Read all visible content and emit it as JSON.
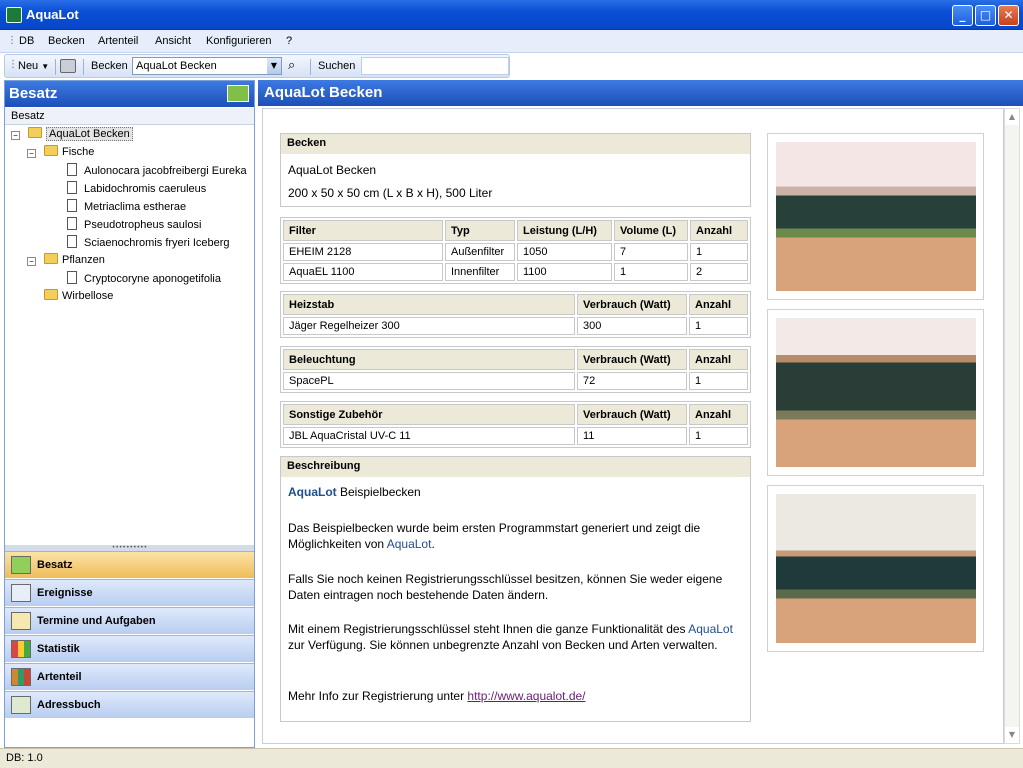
{
  "window": {
    "title": "AquaLot"
  },
  "menu": {
    "items": [
      "DB",
      "Becken",
      "Artenteil",
      "Ansicht",
      "Konfigurieren",
      "?"
    ]
  },
  "toolbar": {
    "new_label": "Neu",
    "becken_label": "Becken",
    "becken_value": "AquaLot Becken",
    "search_label": "Suchen",
    "search_value": ""
  },
  "left": {
    "header": "Besatz",
    "subheader": "Besatz",
    "tree": {
      "root": "AquaLot Becken",
      "fische_label": "Fische",
      "fische": [
        "Aulonocara jacobfreibergi Eureka",
        "Labidochromis caeruleus",
        "Metriaclima estherae",
        "Pseudotropheus saulosi",
        "Sciaenochromis fryeri Iceberg"
      ],
      "pflanzen_label": "Pflanzen",
      "pflanzen": [
        "Cryptocoryne aponogetifolia"
      ],
      "wirbellose_label": "Wirbellose"
    },
    "nav": [
      "Besatz",
      "Ereignisse",
      "Termine und Aufgaben",
      "Statistik",
      "Artenteil",
      "Adressbuch"
    ]
  },
  "main": {
    "header": "AquaLot Becken",
    "becken": {
      "title": "Becken",
      "name": "AquaLot Becken",
      "dimensions": "200 x 50 x 50 cm (L x B x H), 500 Liter"
    },
    "filter": {
      "headers": [
        "Filter",
        "Typ",
        "Leistung (L/H)",
        "Volume (L)",
        "Anzahl"
      ],
      "rows": [
        [
          "EHEIM 2128",
          "Außenfilter",
          "1050",
          "7",
          "1"
        ],
        [
          "AquaEL 1100",
          "Innenfilter",
          "1100",
          "1",
          "2"
        ]
      ]
    },
    "heizstab": {
      "headers": [
        "Heizstab",
        "Verbrauch (Watt)",
        "Anzahl"
      ],
      "rows": [
        [
          "Jäger Regelheizer 300",
          "300",
          "1"
        ]
      ]
    },
    "beleuchtung": {
      "headers": [
        "Beleuchtung",
        "Verbrauch (Watt)",
        "Anzahl"
      ],
      "rows": [
        [
          "SpacePL",
          "72",
          "1"
        ]
      ]
    },
    "zubehoer": {
      "headers": [
        "Sonstige Zubehör",
        "Verbrauch (Watt)",
        "Anzahl"
      ],
      "rows": [
        [
          "JBL AquaCristal UV-C 11",
          "11",
          "1"
        ]
      ]
    },
    "beschreibung": {
      "title": "Beschreibung",
      "brand": "AquaLot",
      "heading_rest": " Beispielbecken",
      "p1_a": "Das Beispielbecken wurde beim ersten Programmstart generiert und zeigt die Möglichkeiten von ",
      "p1_link": "AquaLot",
      "p1_b": ".",
      "p2": "Falls Sie noch keinen Registrierungsschlüssel besitzen, können Sie weder eigene Daten eintragen noch bestehende Daten ändern.",
      "p3_a": "Mit einem Registrierungsschlüssel steht Ihnen die ganze Funktionalität des ",
      "p3_link": "AquaLot",
      "p3_b": " zur Verfügung. Sie können unbegrenzte Anzahl von Becken und Arten verwalten.",
      "p4_a": "Mehr Info zur Registrierung unter ",
      "p4_link": "http://www.aqualot.de/"
    }
  },
  "status": {
    "text": "DB: 1.0"
  }
}
